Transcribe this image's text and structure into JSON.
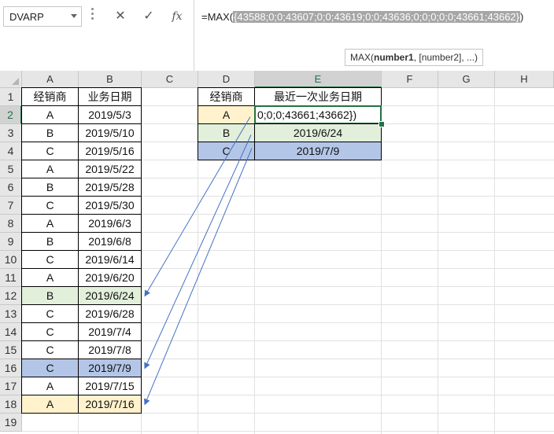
{
  "name_box": {
    "value": "DVARP"
  },
  "formula_bar": {
    "prefix": "=MAX(",
    "selected": "{43588;0;0;43607;0;0;43619;0;0;43636;0;0;0;0;0;43661;43662}",
    "suffix": ")",
    "tooltip_fn": "MAX(",
    "tooltip_arg1": "number1",
    "tooltip_rest": ", [number2], ...)"
  },
  "icons": {
    "cancel": "close-icon",
    "enter": "check-icon",
    "fx": "function-icon"
  },
  "columns": [
    "A",
    "B",
    "C",
    "D",
    "E",
    "F",
    "G",
    "H"
  ],
  "rows": [
    "1",
    "2",
    "3",
    "4",
    "5",
    "6",
    "7",
    "8",
    "9",
    "10",
    "11",
    "12",
    "13",
    "14",
    "15",
    "16",
    "17",
    "18",
    "19"
  ],
  "source_table": {
    "headers": [
      "经销商",
      "业务日期"
    ],
    "rows": [
      [
        "A",
        "2019/5/3"
      ],
      [
        "B",
        "2019/5/10"
      ],
      [
        "C",
        "2019/5/16"
      ],
      [
        "A",
        "2019/5/22"
      ],
      [
        "B",
        "2019/5/28"
      ],
      [
        "C",
        "2019/5/30"
      ],
      [
        "A",
        "2019/6/3"
      ],
      [
        "B",
        "2019/6/8"
      ],
      [
        "C",
        "2019/6/14"
      ],
      [
        "A",
        "2019/6/20"
      ],
      [
        "B",
        "2019/6/24"
      ],
      [
        "C",
        "2019/6/28"
      ],
      [
        "C",
        "2019/7/4"
      ],
      [
        "C",
        "2019/7/8"
      ],
      [
        "C",
        "2019/7/9"
      ],
      [
        "A",
        "2019/7/15"
      ],
      [
        "A",
        "2019/7/16"
      ]
    ],
    "highlights": {
      "green_row": 11,
      "blue_row": 15,
      "yellow_row": 17
    }
  },
  "result_table": {
    "headers": [
      "经销商",
      "最近一次业务日期"
    ],
    "rows": [
      [
        "A",
        "0;0;0;43661;43662})"
      ],
      [
        "B",
        "2019/6/24"
      ],
      [
        "C",
        "2019/7/9"
      ]
    ]
  },
  "colors": {
    "accent": "#217346",
    "green_fill": "#e2efda",
    "blue_fill": "#b4c6e7",
    "yellow_fill": "#fff2cc",
    "arrow": "#4472c4",
    "formula_selection": "#a6a6a6"
  }
}
